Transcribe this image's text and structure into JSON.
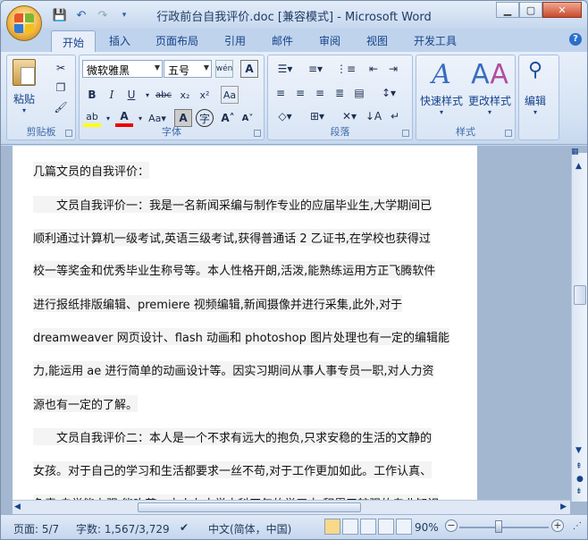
{
  "window": {
    "title": "行政前台自我评价.doc [兼容模式] - Microsoft Word"
  },
  "tabs": [
    "开始",
    "插入",
    "页面布局",
    "引用",
    "邮件",
    "审阅",
    "视图",
    "开发工具"
  ],
  "ribbon": {
    "clipboard": {
      "label": "剪贴板",
      "paste": "粘贴"
    },
    "font": {
      "label": "字体",
      "name": "微软雅黑",
      "size": "五号"
    },
    "paragraph": {
      "label": "段落"
    },
    "styles": {
      "label": "样式",
      "quick": "快速样式",
      "change": "更改样式"
    },
    "editing": {
      "label": "编辑"
    }
  },
  "document": {
    "lines": [
      "几篇文员的自我评价：",
      "　　文员自我评价一：我是一名新闻采编与制作专业的应届毕业生,大学期间已",
      "顺利通过计算机一级考试,英语三级考试,获得普通话 2 乙证书,在学校也获得过",
      "校一等奖金和优秀毕业生称号等。本人性格开朗,活泼,能熟练运用方正飞腾软件",
      "进行报纸排版编辑、premiere 视频编辑,新闻摄像并进行采集,此外,对于",
      "dreamweaver 网页设计、flash 动画和 photoshop 图片处理也有一定的编辑能",
      "力,能运用 ae 进行简单的动画设计等。因实习期间从事人事专员一职,对人力资",
      "源也有一定的了解。",
      "　　文员自我评价二：本人是一个不求有远大的抱负,只求安稳的生活的文静的",
      "女孩。对于自己的学习和生活都要求一丝不苟,对于工作更加如此。工作认真、",
      "负责,自学能力强,能吃苦。本人在大学本科四年的学习中,积累了较强的专业知识"
    ]
  },
  "status": {
    "page": "页面: 5/7",
    "words": "字数: 1,567/3,729",
    "lang": "中文(简体，中国)",
    "zoom": "90%"
  }
}
